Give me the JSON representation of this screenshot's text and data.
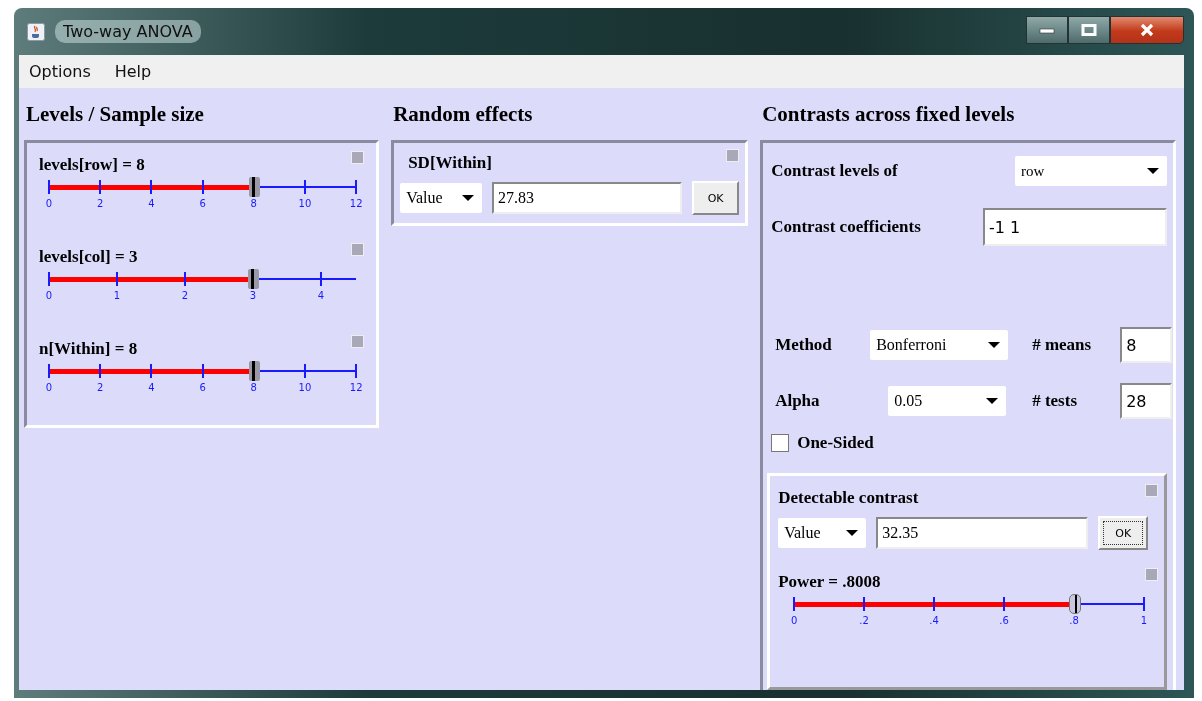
{
  "window": {
    "title": "Two-way ANOVA"
  },
  "menu": [
    {
      "label": "Options"
    },
    {
      "label": "Help"
    }
  ],
  "levels_panel": {
    "heading": "Levels / Sample size",
    "sliders": [
      {
        "label": "levels[row] = 8",
        "level": 0.667,
        "ticks": [
          "0",
          "2",
          "4",
          "6",
          "8",
          "10",
          "12"
        ],
        "open_end": false
      },
      {
        "label": "levels[col] = 3",
        "level": 0.665,
        "ticks": [
          "0",
          "1",
          "2",
          "3",
          "4"
        ],
        "open_end": true
      },
      {
        "label": "n[Within] = 8",
        "level": 0.667,
        "ticks": [
          "0",
          "2",
          "4",
          "6",
          "8",
          "10",
          "12"
        ],
        "open_end": false
      }
    ]
  },
  "random_effects": {
    "heading": "Random effects",
    "title": "SD[Within]",
    "mode": "Value",
    "value": "27.83",
    "button": "OK"
  },
  "contrasts": {
    "heading": "Contrasts across fixed levels",
    "levels_of": {
      "label": "Contrast levels of",
      "value": "row"
    },
    "coefficients": {
      "label": "Contrast coefficients",
      "value": "-1 1"
    },
    "method": {
      "label": "Method",
      "value": "Bonferroni"
    },
    "means": {
      "label": "# means",
      "value": "8"
    },
    "alpha": {
      "label": "Alpha",
      "value": "0.05"
    },
    "tests": {
      "label": "# tests",
      "value": "28"
    },
    "one_sided": {
      "label": "One-Sided",
      "checked": false
    },
    "detectable": {
      "title": "Detectable contrast",
      "mode": "Value",
      "value": "32.35",
      "button": "OK"
    },
    "power": {
      "label": "Power = .8008",
      "level": 0.802,
      "ticks": [
        "0",
        ".2",
        ".4",
        ".6",
        ".8",
        "1"
      ],
      "open_end": false
    }
  }
}
